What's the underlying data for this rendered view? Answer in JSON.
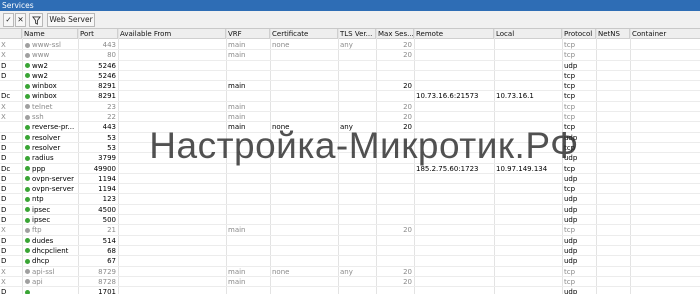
{
  "window": {
    "title": "Services"
  },
  "toolbar": {
    "check_label": "✓",
    "cross_label": "✕",
    "filter_icon": "funnel-icon",
    "web_server_label": "Web Server"
  },
  "columns": [
    "",
    "Name",
    "Port",
    "Available From",
    "VRF",
    "Certificate",
    "TLS Ver...",
    "Max Ses...",
    "Remote",
    "Local",
    "Protocol",
    "NetNS",
    "Container"
  ],
  "colors": {
    "running": "#3aa535",
    "disabled": "#a0a0a0",
    "title_bar": "#2e6db5"
  },
  "rows": [
    {
      "flag": "X",
      "name": "www-ssl",
      "port": "443",
      "available_from": "",
      "vrf": "main",
      "certificate": "none",
      "tls": "any",
      "max_sessions": "20",
      "remote": "",
      "local": "",
      "protocol": "tcp",
      "netns": "",
      "container": "",
      "status": "disabled"
    },
    {
      "flag": "X",
      "name": "www",
      "port": "80",
      "available_from": "",
      "vrf": "main",
      "certificate": "",
      "tls": "",
      "max_sessions": "20",
      "remote": "",
      "local": "",
      "protocol": "tcp",
      "netns": "",
      "container": "",
      "status": "disabled"
    },
    {
      "flag": "D",
      "name": "ww2",
      "port": "5246",
      "available_from": "",
      "vrf": "",
      "certificate": "",
      "tls": "",
      "max_sessions": "",
      "remote": "",
      "local": "",
      "protocol": "udp",
      "netns": "",
      "container": "",
      "status": "running"
    },
    {
      "flag": "D",
      "name": "ww2",
      "port": "5246",
      "available_from": "",
      "vrf": "",
      "certificate": "",
      "tls": "",
      "max_sessions": "",
      "remote": "",
      "local": "",
      "protocol": "tcp",
      "netns": "",
      "container": "",
      "status": "running"
    },
    {
      "flag": "",
      "name": "winbox",
      "port": "8291",
      "available_from": "",
      "vrf": "main",
      "certificate": "",
      "tls": "",
      "max_sessions": "20",
      "remote": "",
      "local": "",
      "protocol": "tcp",
      "netns": "",
      "container": "",
      "status": "running"
    },
    {
      "flag": "Dc",
      "name": "winbox",
      "port": "8291",
      "available_from": "",
      "vrf": "",
      "certificate": "",
      "tls": "",
      "max_sessions": "",
      "remote": "10.73.16.6:21573",
      "local": "10.73.16.1",
      "protocol": "tcp",
      "netns": "",
      "container": "",
      "status": "running"
    },
    {
      "flag": "X",
      "name": "telnet",
      "port": "23",
      "available_from": "",
      "vrf": "main",
      "certificate": "",
      "tls": "",
      "max_sessions": "20",
      "remote": "",
      "local": "",
      "protocol": "tcp",
      "netns": "",
      "container": "",
      "status": "disabled"
    },
    {
      "flag": "X",
      "name": "ssh",
      "port": "22",
      "available_from": "",
      "vrf": "main",
      "certificate": "",
      "tls": "",
      "max_sessions": "20",
      "remote": "",
      "local": "",
      "protocol": "tcp",
      "netns": "",
      "container": "",
      "status": "disabled"
    },
    {
      "flag": "",
      "name": "reverse-pr...",
      "port": "443",
      "available_from": "",
      "vrf": "main",
      "certificate": "none",
      "tls": "any",
      "max_sessions": "20",
      "remote": "",
      "local": "",
      "protocol": "tcp",
      "netns": "",
      "container": "",
      "status": "running"
    },
    {
      "flag": "D",
      "name": "resolver",
      "port": "53",
      "available_from": "",
      "vrf": "",
      "certificate": "",
      "tls": "",
      "max_sessions": "",
      "remote": "",
      "local": "",
      "protocol": "udp",
      "netns": "",
      "container": "",
      "status": "running"
    },
    {
      "flag": "D",
      "name": "resolver",
      "port": "53",
      "available_from": "",
      "vrf": "",
      "certificate": "",
      "tls": "",
      "max_sessions": "",
      "remote": "",
      "local": "",
      "protocol": "tcp",
      "netns": "",
      "container": "",
      "status": "running"
    },
    {
      "flag": "D",
      "name": "radius",
      "port": "3799",
      "available_from": "",
      "vrf": "",
      "certificate": "",
      "tls": "",
      "max_sessions": "",
      "remote": "",
      "local": "",
      "protocol": "udp",
      "netns": "",
      "container": "",
      "status": "running"
    },
    {
      "flag": "Dc",
      "name": "ppp",
      "port": "49900",
      "available_from": "",
      "vrf": "",
      "certificate": "",
      "tls": "",
      "max_sessions": "",
      "remote": "185.2.75.60:1723",
      "local": "10.97.149.134",
      "protocol": "tcp",
      "netns": "",
      "container": "",
      "status": "running"
    },
    {
      "flag": "D",
      "name": "ovpn-server",
      "port": "1194",
      "available_from": "",
      "vrf": "",
      "certificate": "",
      "tls": "",
      "max_sessions": "",
      "remote": "",
      "local": "",
      "protocol": "udp",
      "netns": "",
      "container": "",
      "status": "running"
    },
    {
      "flag": "D",
      "name": "ovpn-server",
      "port": "1194",
      "available_from": "",
      "vrf": "",
      "certificate": "",
      "tls": "",
      "max_sessions": "",
      "remote": "",
      "local": "",
      "protocol": "tcp",
      "netns": "",
      "container": "",
      "status": "running"
    },
    {
      "flag": "D",
      "name": "ntp",
      "port": "123",
      "available_from": "",
      "vrf": "",
      "certificate": "",
      "tls": "",
      "max_sessions": "",
      "remote": "",
      "local": "",
      "protocol": "udp",
      "netns": "",
      "container": "",
      "status": "running"
    },
    {
      "flag": "D",
      "name": "ipsec",
      "port": "4500",
      "available_from": "",
      "vrf": "",
      "certificate": "",
      "tls": "",
      "max_sessions": "",
      "remote": "",
      "local": "",
      "protocol": "udp",
      "netns": "",
      "container": "",
      "status": "running"
    },
    {
      "flag": "D",
      "name": "ipsec",
      "port": "500",
      "available_from": "",
      "vrf": "",
      "certificate": "",
      "tls": "",
      "max_sessions": "",
      "remote": "",
      "local": "",
      "protocol": "udp",
      "netns": "",
      "container": "",
      "status": "running"
    },
    {
      "flag": "X",
      "name": "ftp",
      "port": "21",
      "available_from": "",
      "vrf": "main",
      "certificate": "",
      "tls": "",
      "max_sessions": "20",
      "remote": "",
      "local": "",
      "protocol": "tcp",
      "netns": "",
      "container": "",
      "status": "disabled"
    },
    {
      "flag": "D",
      "name": "dudes",
      "port": "514",
      "available_from": "",
      "vrf": "",
      "certificate": "",
      "tls": "",
      "max_sessions": "",
      "remote": "",
      "local": "",
      "protocol": "udp",
      "netns": "",
      "container": "",
      "status": "running"
    },
    {
      "flag": "D",
      "name": "dhcpclient",
      "port": "68",
      "available_from": "",
      "vrf": "",
      "certificate": "",
      "tls": "",
      "max_sessions": "",
      "remote": "",
      "local": "",
      "protocol": "udp",
      "netns": "",
      "container": "",
      "status": "running"
    },
    {
      "flag": "D",
      "name": "dhcp",
      "port": "67",
      "available_from": "",
      "vrf": "",
      "certificate": "",
      "tls": "",
      "max_sessions": "",
      "remote": "",
      "local": "",
      "protocol": "udp",
      "netns": "",
      "container": "",
      "status": "running"
    },
    {
      "flag": "X",
      "name": "api-ssl",
      "port": "8729",
      "available_from": "",
      "vrf": "main",
      "certificate": "none",
      "tls": "any",
      "max_sessions": "20",
      "remote": "",
      "local": "",
      "protocol": "tcp",
      "netns": "",
      "container": "",
      "status": "disabled"
    },
    {
      "flag": "X",
      "name": "api",
      "port": "8728",
      "available_from": "",
      "vrf": "main",
      "certificate": "",
      "tls": "",
      "max_sessions": "20",
      "remote": "",
      "local": "",
      "protocol": "tcp",
      "netns": "",
      "container": "",
      "status": "disabled"
    },
    {
      "flag": "D",
      "name": "",
      "port": "1701",
      "available_from": "",
      "vrf": "",
      "certificate": "",
      "tls": "",
      "max_sessions": "",
      "remote": "",
      "local": "",
      "protocol": "udp",
      "netns": "",
      "container": "",
      "status": "running"
    }
  ],
  "watermark": {
    "text": "Настройка-Микротик.РФ"
  }
}
